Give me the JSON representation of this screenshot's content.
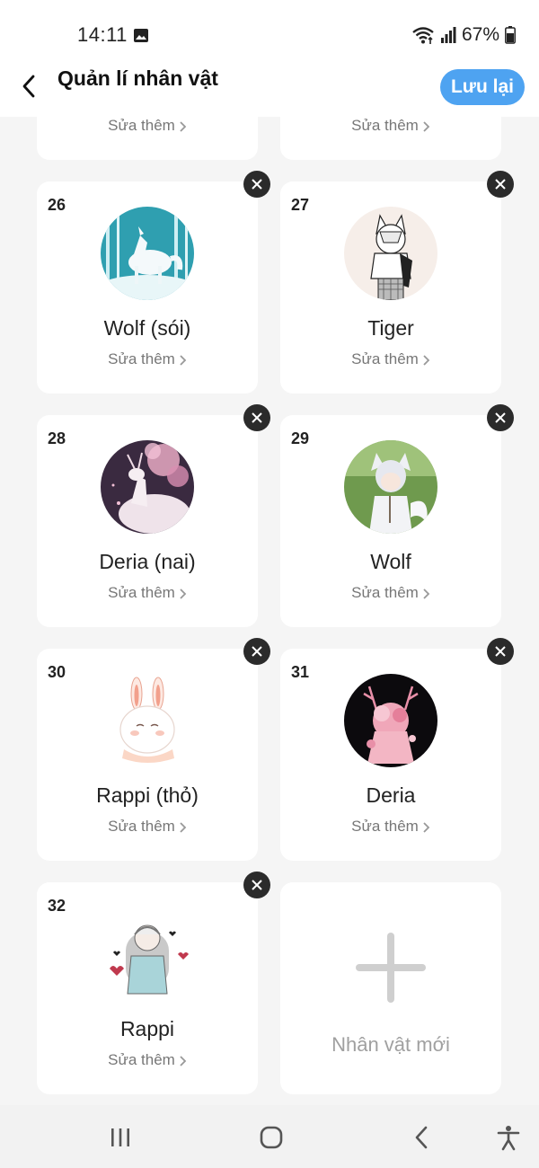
{
  "status_bar": {
    "time": "14:11",
    "battery": "67%",
    "icons": [
      "image-icon",
      "wifi-icon",
      "signal-icon",
      "battery-icon"
    ]
  },
  "header": {
    "title": "Quản lí nhân vật",
    "save_label": "Lưu lại",
    "back_icon": "chevron-left-icon"
  },
  "colors": {
    "accent": "#4ea3f1",
    "background": "#f5f5f5",
    "card": "#ffffff",
    "remove_button": "#2b2b2b"
  },
  "edit_label": "Sửa thêm",
  "characters": [
    {
      "number": "26",
      "name": "Wolf (sói)",
      "avatar": "white-wolf-in-winter-forest"
    },
    {
      "number": "27",
      "name": "Tiger",
      "avatar": "white-haired-boy-sketch"
    },
    {
      "number": "28",
      "name": "Deria (nai)",
      "avatar": "white-deer-with-pink-blossoms"
    },
    {
      "number": "29",
      "name": "Wolf",
      "avatar": "white-haired-boy-with-wolf-tail"
    },
    {
      "number": "30",
      "name": "Rappi (thỏ)",
      "avatar": "white-bunny"
    },
    {
      "number": "31",
      "name": "Deria",
      "avatar": "pink-blossom-deer-girl"
    },
    {
      "number": "32",
      "name": "Rappi",
      "avatar": "girl-in-hoodie-with-hearts"
    }
  ],
  "new_character_label": "Nhân vật mới",
  "nav_bar": {
    "buttons": [
      "recent-apps-icon",
      "home-icon",
      "back-icon",
      "accessibility-icon"
    ]
  }
}
